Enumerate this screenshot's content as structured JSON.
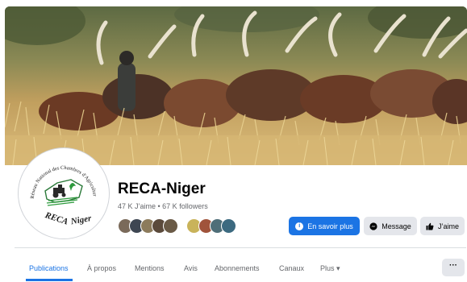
{
  "page": {
    "name": "RECA-Niger",
    "stats": "47 K J’aime • 67 K followers"
  },
  "logo": {
    "arc_text": "Réseau National des Chambres d'Agriculture du Niger",
    "name": "RECA",
    "country": "Niger"
  },
  "actions": {
    "learn_more": "En savoir plus",
    "message": "Message",
    "like": "J’aime"
  },
  "tabs": [
    {
      "label": "Publications",
      "active": true
    },
    {
      "label": "À propos"
    },
    {
      "label": "Mentions"
    },
    {
      "label": "Avis"
    },
    {
      "label": "Abonnements"
    },
    {
      "label": "Canaux"
    },
    {
      "label": "Plus ▾"
    }
  ],
  "more_menu": "···",
  "colors": {
    "accent": "#1b74e4",
    "secondary_button": "#e4e6eb",
    "muted_text": "#65676b"
  },
  "icons": [
    "info-icon",
    "messenger-icon",
    "thumbs-up-icon",
    "tractor-icon"
  ]
}
